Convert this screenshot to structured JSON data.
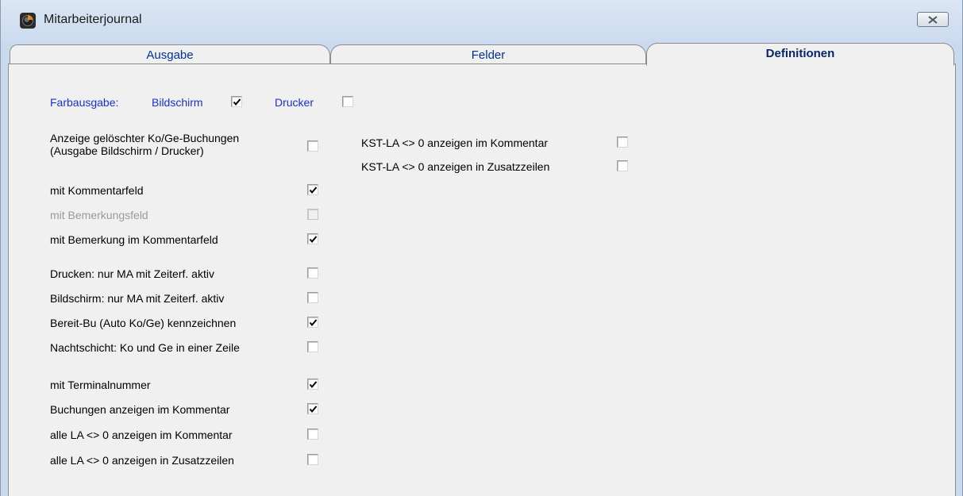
{
  "window": {
    "title": "Mitarbeiterjournal",
    "close_icon": "close-icon"
  },
  "tabs": [
    {
      "label": "Ausgabe",
      "active": false
    },
    {
      "label": "Felder",
      "active": false
    },
    {
      "label": "Definitionen",
      "active": true
    }
  ],
  "color_output": {
    "label": "Farbausgabe:",
    "screen": {
      "label": "Bildschirm",
      "checked": true
    },
    "printer": {
      "label": "Drucker",
      "checked": false
    }
  },
  "options_left": [
    {
      "label": "Anzeige gelöschter Ko/Ge-Buchungen",
      "label2": "(Ausgabe Bildschirm / Drucker)",
      "checked": false,
      "disabled": false
    },
    {
      "label": "mit Kommentarfeld",
      "checked": true,
      "disabled": false
    },
    {
      "label": "mit Bemerkungsfeld",
      "checked": false,
      "disabled": true
    },
    {
      "label": "mit Bemerkung im Kommentarfeld",
      "checked": true,
      "disabled": false
    },
    {
      "label": "Drucken: nur MA mit Zeiterf. aktiv",
      "checked": false,
      "disabled": false
    },
    {
      "label": "Bildschirm: nur MA mit Zeiterf. aktiv",
      "checked": false,
      "disabled": false
    },
    {
      "label": "Bereit-Bu (Auto Ko/Ge) kennzeichnen",
      "checked": true,
      "disabled": false
    },
    {
      "label": "Nachtschicht: Ko und Ge in einer Zeile",
      "checked": false,
      "disabled": false
    },
    {
      "label": "mit Terminalnummer",
      "checked": true,
      "disabled": false
    },
    {
      "label": "Buchungen anzeigen im Kommentar",
      "checked": true,
      "disabled": false
    },
    {
      "label": "alle LA <> 0 anzeigen im Kommentar",
      "checked": false,
      "disabled": false
    },
    {
      "label": "alle LA <> 0 anzeigen in Zusatzzeilen",
      "checked": false,
      "disabled": false
    }
  ],
  "options_right": [
    {
      "label": "KST-LA <> 0 anzeigen im Kommentar",
      "checked": false
    },
    {
      "label": "KST-LA <> 0 anzeigen in Zusatzzeilen",
      "checked": false
    }
  ]
}
